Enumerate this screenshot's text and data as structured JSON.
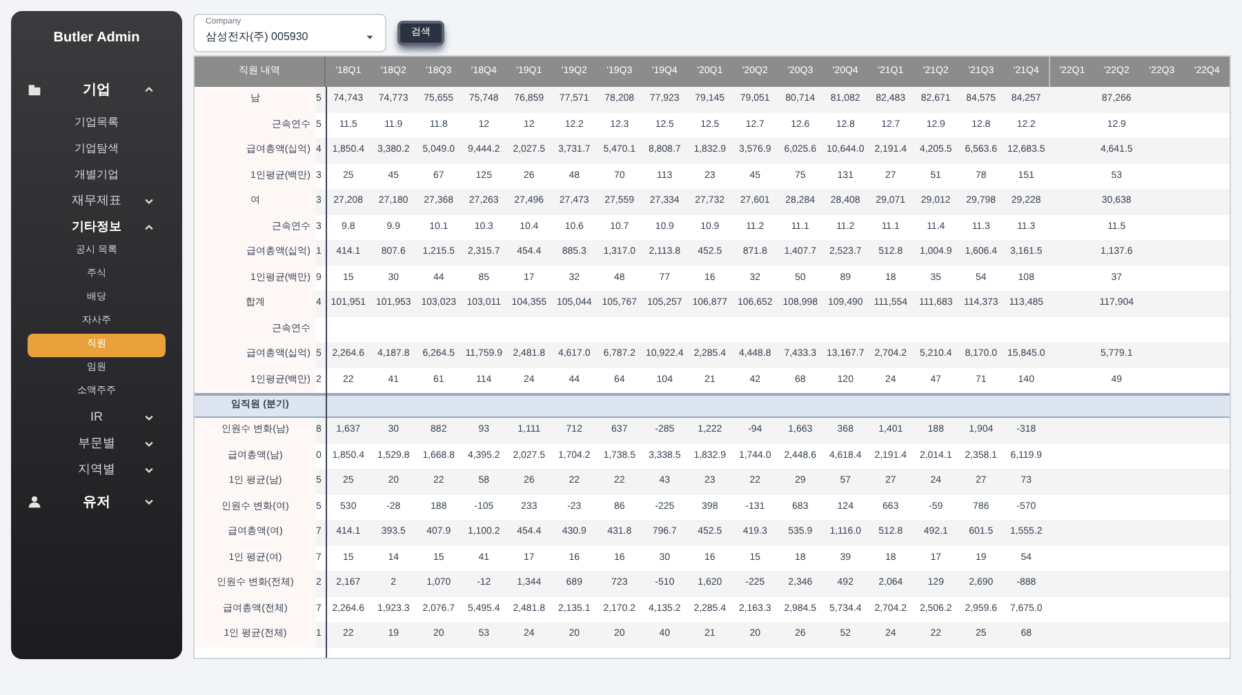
{
  "sidebar": {
    "title": "Butler Admin",
    "menu": [
      {
        "label": "기업",
        "kind": "group",
        "expanded": true,
        "children": [
          {
            "label": "기업목록",
            "kind": "link",
            "selected": false
          },
          {
            "label": "기업탐색",
            "kind": "link",
            "selected": false
          },
          {
            "label": "개별기업",
            "kind": "link",
            "selected": false
          },
          {
            "label": "재무제표",
            "kind": "folder",
            "expanded": false
          },
          {
            "label": "기타정보",
            "kind": "folder",
            "expanded": true,
            "children": [
              {
                "label": "공시 목록",
                "kind": "link",
                "selected": false
              },
              {
                "label": "주식",
                "kind": "link",
                "selected": false
              },
              {
                "label": "배당",
                "kind": "link",
                "selected": false
              },
              {
                "label": "자사주",
                "kind": "link",
                "selected": false
              },
              {
                "label": "직원",
                "kind": "link",
                "selected": true
              },
              {
                "label": "임원",
                "kind": "link",
                "selected": false
              },
              {
                "label": "소액주주",
                "kind": "link",
                "selected": false
              }
            ]
          },
          {
            "label": "IR",
            "kind": "folder",
            "expanded": false
          },
          {
            "label": "부문별",
            "kind": "folder",
            "expanded": false
          },
          {
            "label": "지역별",
            "kind": "folder",
            "expanded": false
          }
        ]
      },
      {
        "label": "유저",
        "kind": "group",
        "expanded": false
      }
    ]
  },
  "company_select": {
    "label": "Company",
    "value": "삼성전자(주) 005930"
  },
  "search_button": "검색",
  "table": {
    "columns": [
      "직원 내역",
      "'18Q1",
      "'18Q2",
      "'18Q3",
      "'18Q4",
      "'19Q1",
      "'19Q2",
      "'19Q3",
      "'19Q4",
      "'20Q1",
      "'20Q2",
      "'20Q3",
      "'20Q4",
      "'21Q1",
      "'21Q2",
      "'21Q3",
      "'21Q4",
      "'22Q1",
      "'22Q2",
      "'22Q3",
      "'22Q4"
    ],
    "sections": [
      {
        "rows": [
          {
            "label": "남",
            "kind": "group",
            "cut": "5",
            "values": [
              "74,743",
              "74,773",
              "75,655",
              "75,748",
              "76,859",
              "77,571",
              "78,208",
              "77,923",
              "79,145",
              "79,051",
              "80,714",
              "81,082",
              "82,483",
              "82,671",
              "84,575",
              "84,257"
            ],
            "value_22q2": "87,266"
          },
          {
            "label": "근속연수",
            "kind": "sub",
            "cut": "5",
            "values": [
              "11.5",
              "11.9",
              "11.8",
              "12",
              "12",
              "12.2",
              "12.3",
              "12.5",
              "12.5",
              "12.7",
              "12.6",
              "12.8",
              "12.7",
              "12.9",
              "12.8",
              "12.2"
            ],
            "value_22q2": "12.9"
          },
          {
            "label": "급여총액(십억)",
            "kind": "sub",
            "cut": "4",
            "values": [
              "1,850.4",
              "3,380.2",
              "5,049.0",
              "9,444.2",
              "2,027.5",
              "3,731.7",
              "5,470.1",
              "8,808.7",
              "1,832.9",
              "3,576.9",
              "6,025.6",
              "10,644.0",
              "2,191.4",
              "4,205.5",
              "6,563.6",
              "12,683.5"
            ],
            "value_22q2": "4,641.5"
          },
          {
            "label": "1인평균(백만)",
            "kind": "sub",
            "cut": "3",
            "values": [
              "25",
              "45",
              "67",
              "125",
              "26",
              "48",
              "70",
              "113",
              "23",
              "45",
              "75",
              "131",
              "27",
              "51",
              "78",
              "151"
            ],
            "value_22q2": "53"
          },
          {
            "label": "여",
            "kind": "group",
            "cut": "3",
            "values": [
              "27,208",
              "27,180",
              "27,368",
              "27,263",
              "27,496",
              "27,473",
              "27,559",
              "27,334",
              "27,732",
              "27,601",
              "28,284",
              "28,408",
              "29,071",
              "29,012",
              "29,798",
              "29,228"
            ],
            "value_22q2": "30,638"
          },
          {
            "label": "근속연수",
            "kind": "sub",
            "cut": "3",
            "values": [
              "9.8",
              "9.9",
              "10.1",
              "10.3",
              "10.4",
              "10.6",
              "10.7",
              "10.9",
              "10.9",
              "11.2",
              "11.1",
              "11.2",
              "11.1",
              "11.4",
              "11.3",
              "11.3"
            ],
            "value_22q2": "11.5"
          },
          {
            "label": "급여총액(십억)",
            "kind": "sub",
            "cut": "1",
            "values": [
              "414.1",
              "807.6",
              "1,215.5",
              "2,315.7",
              "454.4",
              "885.3",
              "1,317.0",
              "2,113.8",
              "452.5",
              "871.8",
              "1,407.7",
              "2,523.7",
              "512.8",
              "1,004.9",
              "1,606.4",
              "3,161.5"
            ],
            "value_22q2": "1,137.6"
          },
          {
            "label": "1인평균(백만)",
            "kind": "sub",
            "cut": "9",
            "values": [
              "15",
              "30",
              "44",
              "85",
              "17",
              "32",
              "48",
              "77",
              "16",
              "32",
              "50",
              "89",
              "18",
              "35",
              "54",
              "108"
            ],
            "value_22q2": "37"
          },
          {
            "label": "합계",
            "kind": "group",
            "cut": "4",
            "values": [
              "101,951",
              "101,953",
              "103,023",
              "103,011",
              "104,355",
              "105,044",
              "105,767",
              "105,257",
              "106,877",
              "106,652",
              "108,998",
              "109,490",
              "111,554",
              "111,683",
              "114,373",
              "113,485"
            ],
            "value_22q2": "117,904"
          },
          {
            "label": "근속연수",
            "kind": "sub"
          },
          {
            "label": "급여총액(십억)",
            "kind": "sub",
            "cut": "5",
            "values": [
              "2,264.6",
              "4,187.8",
              "6,264.5",
              "11,759.9",
              "2,481.8",
              "4,617.0",
              "6,787.2",
              "10,922.4",
              "2,285.4",
              "4,448.8",
              "7,433.3",
              "13,167.7",
              "2,704.2",
              "5,210.4",
              "8,170.0",
              "15,845.0"
            ],
            "value_22q2": "5,779.1"
          },
          {
            "label": "1인평균(백만)",
            "kind": "sub",
            "cut": "2",
            "values": [
              "22",
              "41",
              "61",
              "114",
              "24",
              "44",
              "64",
              "104",
              "21",
              "42",
              "68",
              "120",
              "24",
              "47",
              "71",
              "140"
            ],
            "value_22q2": "49"
          }
        ]
      },
      {
        "title": "임직원 (분기)",
        "rows": [
          {
            "label": "인원수 변화(남)",
            "kind": "metric",
            "cut": "8",
            "values": [
              "1,637",
              "30",
              "882",
              "93",
              "1,111",
              "712",
              "637",
              "-285",
              "1,222",
              "-94",
              "1,663",
              "368",
              "1,401",
              "188",
              "1,904",
              "-318"
            ]
          },
          {
            "label": "급여총액(남)",
            "kind": "metric",
            "cut": "0",
            "values": [
              "1,850.4",
              "1,529.8",
              "1,668.8",
              "4,395.2",
              "2,027.5",
              "1,704.2",
              "1,738.5",
              "3,338.5",
              "1,832.9",
              "1,744.0",
              "2,448.6",
              "4,618.4",
              "2,191.4",
              "2,014.1",
              "2,358.1",
              "6,119.9"
            ]
          },
          {
            "label": "1인 평균(남)",
            "kind": "metric",
            "cut": "5",
            "values": [
              "25",
              "20",
              "22",
              "58",
              "26",
              "22",
              "22",
              "43",
              "23",
              "22",
              "29",
              "57",
              "27",
              "24",
              "27",
              "73"
            ]
          },
          {
            "label": "인원수 변화(여)",
            "kind": "metric",
            "cut": "5",
            "values": [
              "530",
              "-28",
              "188",
              "-105",
              "233",
              "-23",
              "86",
              "-225",
              "398",
              "-131",
              "683",
              "124",
              "663",
              "-59",
              "786",
              "-570"
            ]
          },
          {
            "label": "급여총액(여)",
            "kind": "metric",
            "cut": "7",
            "values": [
              "414.1",
              "393.5",
              "407.9",
              "1,100.2",
              "454.4",
              "430.9",
              "431.8",
              "796.7",
              "452.5",
              "419.3",
              "535.9",
              "1,116.0",
              "512.8",
              "492.1",
              "601.5",
              "1,555.2"
            ]
          },
          {
            "label": "1인 평균(여)",
            "kind": "metric",
            "cut": "7",
            "values": [
              "15",
              "14",
              "15",
              "41",
              "17",
              "16",
              "16",
              "30",
              "16",
              "15",
              "18",
              "39",
              "18",
              "17",
              "19",
              "54"
            ]
          },
          {
            "label": "인원수 변화(전체)",
            "kind": "metric",
            "cut": "2",
            "values": [
              "2,167",
              "2",
              "1,070",
              "-12",
              "1,344",
              "689",
              "723",
              "-510",
              "1,620",
              "-225",
              "2,346",
              "492",
              "2,064",
              "129",
              "2,690",
              "-888"
            ]
          },
          {
            "label": "급여총액(전체)",
            "kind": "metric",
            "cut": "7",
            "values": [
              "2,264.6",
              "1,923.3",
              "2,076.7",
              "5,495.4",
              "2,481.8",
              "2,135.1",
              "2,170.2",
              "4,135.2",
              "2,285.4",
              "2,163.3",
              "2,984.5",
              "5,734.4",
              "2,704.2",
              "2,506.2",
              "2,959.6",
              "7,675.0"
            ]
          },
          {
            "label": "1인 평균(전체)",
            "kind": "metric",
            "cut": "1",
            "values": [
              "22",
              "19",
              "20",
              "53",
              "24",
              "20",
              "20",
              "40",
              "21",
              "20",
              "26",
              "52",
              "24",
              "22",
              "25",
              "68"
            ]
          }
        ]
      }
    ]
  }
}
